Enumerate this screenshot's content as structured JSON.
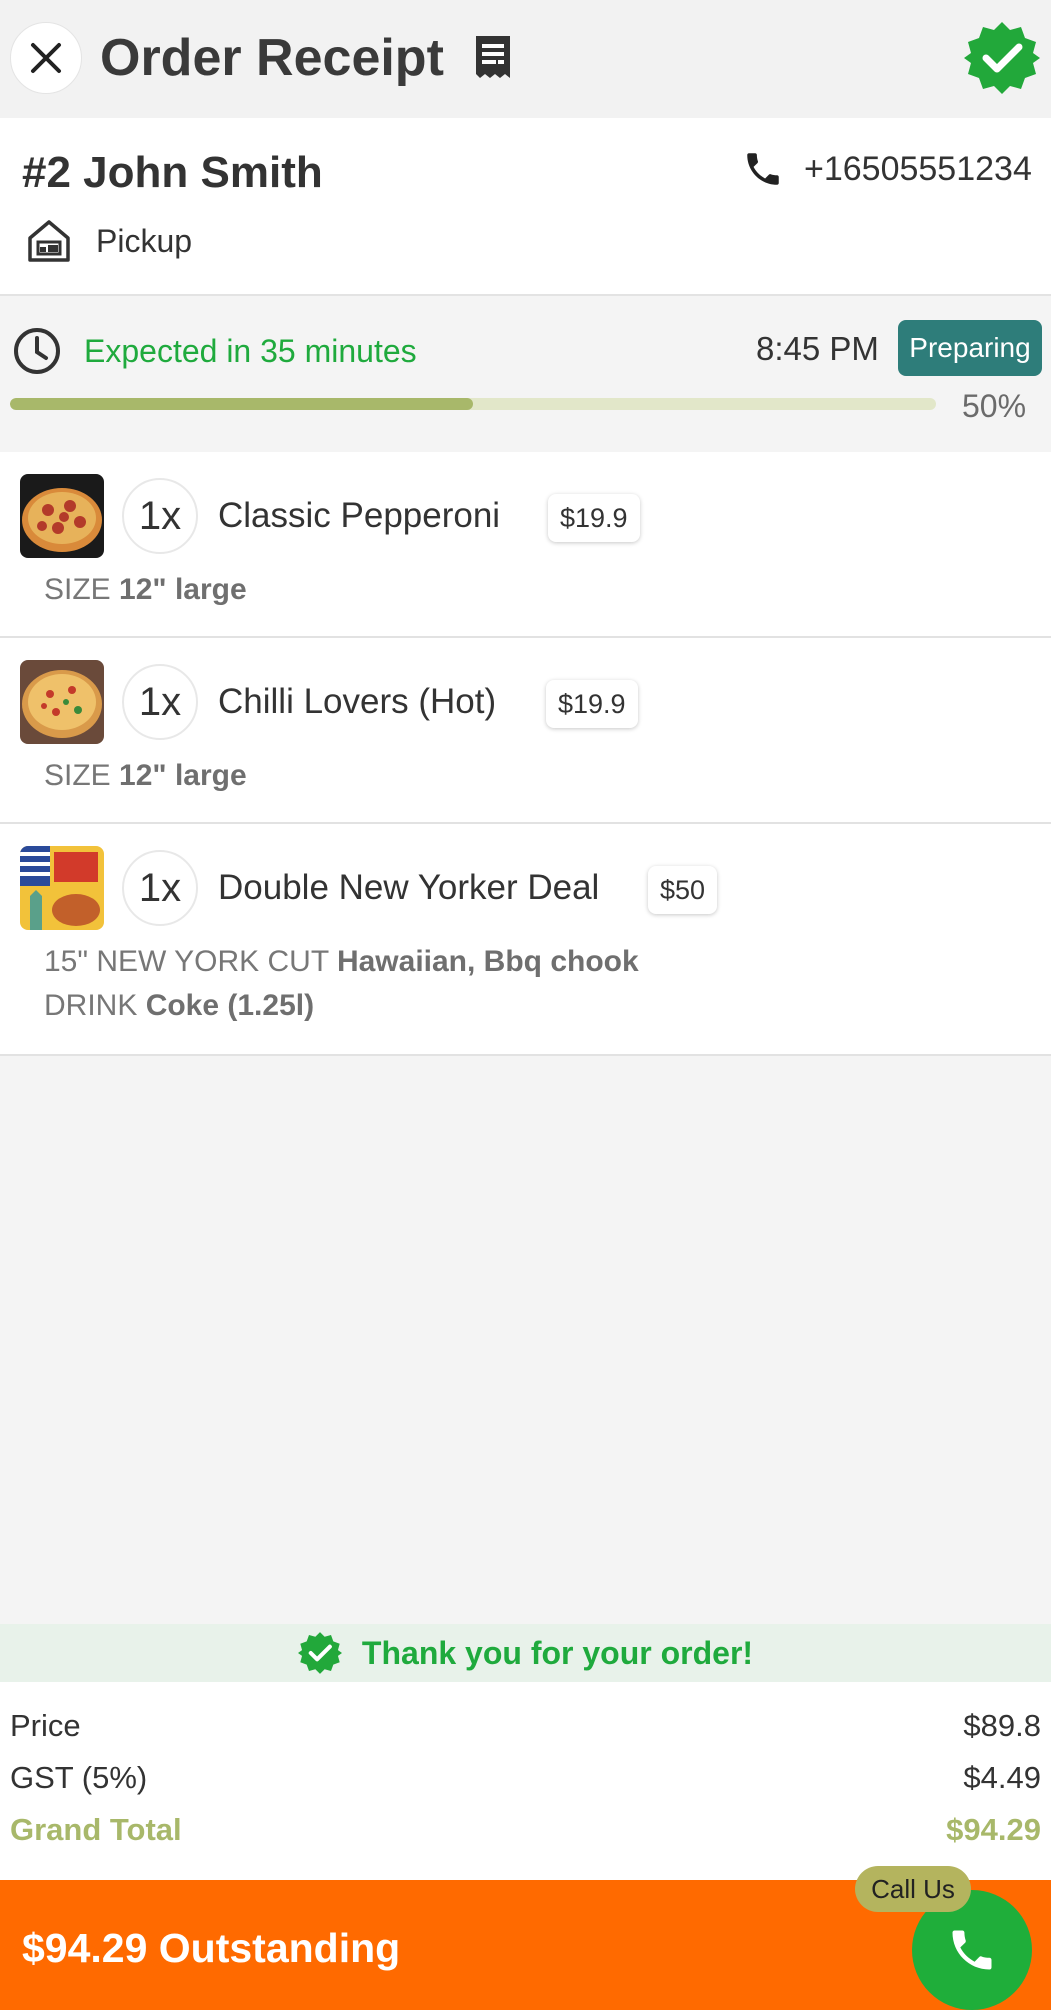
{
  "header": {
    "title": "Order Receipt",
    "close_icon": "close-icon",
    "receipt_icon": "receipt-icon",
    "status_icon": "verified-badge-icon"
  },
  "customer": {
    "order_name": "#2 John Smith",
    "phone": "+16505551234",
    "order_type": "Pickup"
  },
  "status": {
    "eta_text": "Expected in 35 minutes",
    "eta_time": "8:45 PM",
    "badge": "Preparing",
    "progress_label": "50%",
    "progress_value": 0.5
  },
  "items": [
    {
      "qty": "1x",
      "name": "Classic Pepperoni",
      "price": "$19.9",
      "options": [
        {
          "label": "SIZE",
          "value": "12\" large"
        }
      ]
    },
    {
      "qty": "1x",
      "name": "Chilli Lovers (Hot)",
      "price": "$19.9",
      "options": [
        {
          "label": "SIZE",
          "value": "12\" large"
        }
      ]
    },
    {
      "qty": "1x",
      "name": "Double New Yorker Deal",
      "price": "$50",
      "options": [
        {
          "label": "15\" NEW YORK CUT",
          "value": "Hawaiian, Bbq chook"
        },
        {
          "label": "DRINK",
          "value": "Coke (1.25l)"
        }
      ]
    }
  ],
  "thanks": "Thank you for your order!",
  "totals": {
    "price_label": "Price",
    "price_value": "$89.8",
    "gst_label": "GST (5%)",
    "gst_value": "$4.49",
    "grand_label": "Grand Total",
    "grand_value": "$94.29"
  },
  "footer": {
    "outstanding": "$94.29 Outstanding",
    "call_label": "Call Us"
  },
  "colors": {
    "accent_green": "#1faa3d",
    "olive": "#a8b86a",
    "teal_badge": "#2e7d7a",
    "orange_footer": "#ff6a00"
  }
}
